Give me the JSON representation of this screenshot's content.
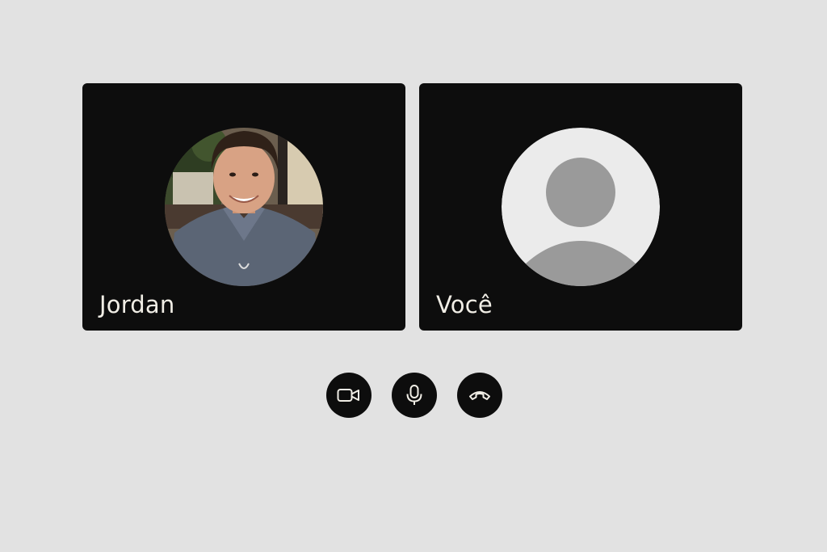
{
  "participants": [
    {
      "name": "Jordan",
      "avatar": "participant-photo"
    },
    {
      "name": "Você",
      "avatar": "default-user-icon"
    }
  ],
  "controls": [
    {
      "action": "toggle-camera",
      "icon": "video-camera-icon"
    },
    {
      "action": "toggle-microphone",
      "icon": "microphone-icon"
    },
    {
      "action": "end-call",
      "icon": "hang-up-icon"
    }
  ],
  "colors": {
    "background": "#e2e2e2",
    "tile": "#0d0d0d",
    "name_text": "#f1eee6",
    "placeholder_circle": "#ebebeb",
    "placeholder_figure": "#9a9a9a"
  }
}
